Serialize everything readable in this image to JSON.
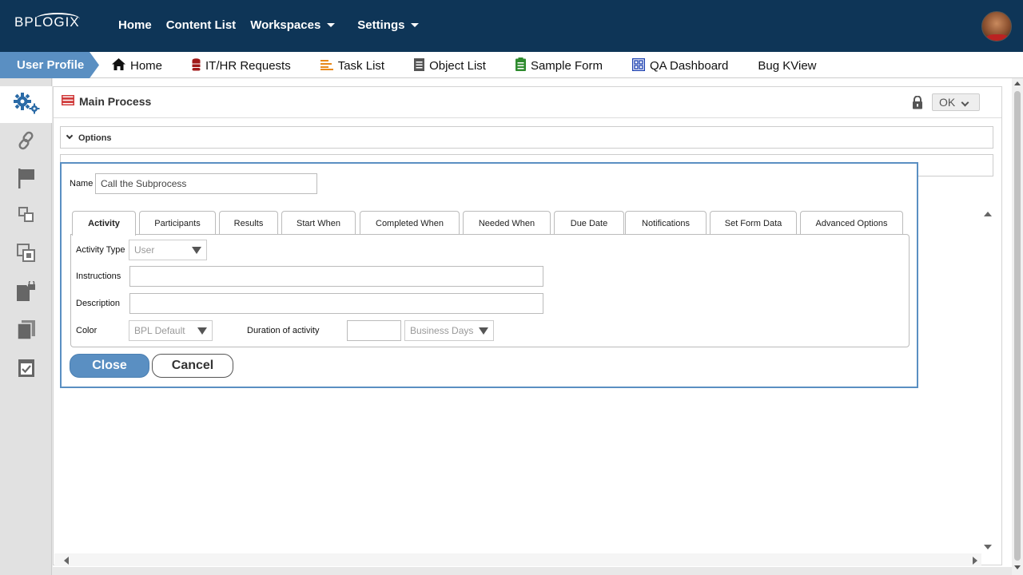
{
  "brand": {
    "logo_text": "BPLOGIX"
  },
  "topnav": {
    "items": [
      {
        "label": "Home"
      },
      {
        "label": "Content List"
      },
      {
        "label": "Workspaces"
      },
      {
        "label": "Settings"
      }
    ]
  },
  "subnav": {
    "active": "User Profile",
    "items": [
      {
        "label": "Home",
        "icon": "home-icon"
      },
      {
        "label": "IT/HR Requests",
        "icon": "database-icon"
      },
      {
        "label": "Task List",
        "icon": "list-icon"
      },
      {
        "label": "Object List",
        "icon": "document-icon"
      },
      {
        "label": "Sample Form",
        "icon": "form-icon"
      },
      {
        "label": "QA Dashboard",
        "icon": "dashboard-icon"
      },
      {
        "label": "Bug KView",
        "icon": ""
      }
    ]
  },
  "sidebar": {
    "icons": [
      "gears-icon",
      "link-icon",
      "flag-icon",
      "subprocess-icon",
      "copy-icon",
      "locked-document-icon",
      "documents-icon",
      "checklist-icon"
    ]
  },
  "main": {
    "title": "Main Process",
    "ok_label": "OK",
    "options_label": "Options"
  },
  "dialog": {
    "name_label": "Name",
    "name_value": "Call the Subprocess",
    "tabs": [
      {
        "label": "Activity",
        "active": true
      },
      {
        "label": "Participants"
      },
      {
        "label": "Results"
      },
      {
        "label": "Start When"
      },
      {
        "label": "Completed When"
      },
      {
        "label": "Needed When"
      },
      {
        "label": "Due Date"
      },
      {
        "label": "Notifications"
      },
      {
        "label": "Set Form Data"
      },
      {
        "label": "Advanced Options"
      }
    ],
    "activity_type_label": "Activity Type",
    "activity_type_value": "User",
    "instructions_label": "Instructions",
    "instructions_value": "",
    "description_label": "Description",
    "description_value": "",
    "color_label": "Color",
    "color_value": "BPL Default",
    "duration_label": "Duration of activity",
    "duration_value": "",
    "duration_unit": "Business Days",
    "close_label": "Close",
    "cancel_label": "Cancel"
  },
  "colors": {
    "navbar": "#0e3557",
    "accent": "#5a8fc2"
  }
}
